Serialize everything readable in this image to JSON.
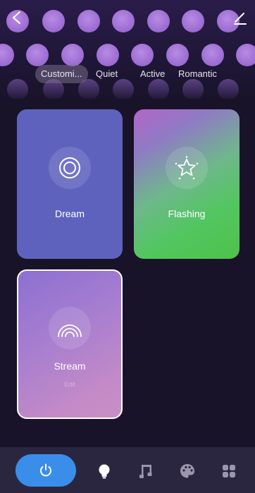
{
  "presets": {
    "chips": [
      "Customi...",
      "Quiet",
      "Active",
      "Romantic"
    ]
  },
  "scenes": [
    {
      "label": "Dream",
      "icon": "concentric-circles-icon"
    },
    {
      "label": "Flashing",
      "icon": "sparkle-star-icon"
    },
    {
      "label": "Stream",
      "sub_label": "Edit",
      "icon": "rainbow-icon",
      "selected": true
    }
  ],
  "bottom_nav": {
    "items": [
      "power-icon",
      "bulb-icon",
      "music-icon",
      "palette-icon",
      "grid-icon"
    ]
  },
  "colors": {
    "power_button": "#3a8ee9",
    "dream_card": "#5f62bd",
    "background": "#19132a"
  }
}
